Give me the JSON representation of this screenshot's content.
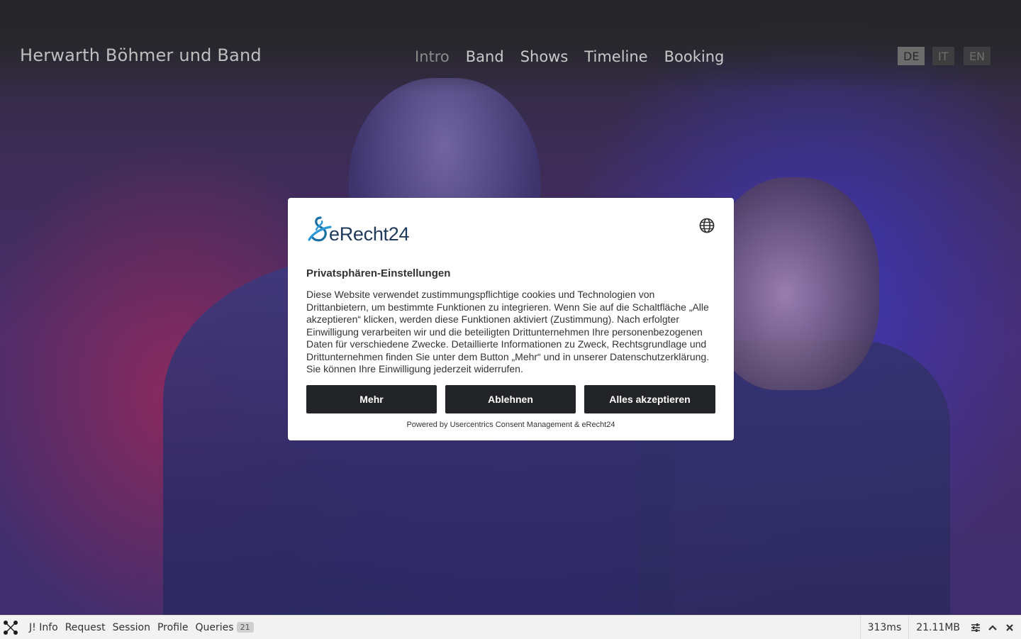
{
  "site": {
    "title": "Herwarth Böhmer und Band"
  },
  "nav": {
    "items": [
      {
        "label": "Intro",
        "active": true
      },
      {
        "label": "Band",
        "active": false
      },
      {
        "label": "Shows",
        "active": false
      },
      {
        "label": "Timeline",
        "active": false
      },
      {
        "label": "Booking",
        "active": false
      }
    ]
  },
  "languages": [
    {
      "code": "DE",
      "active": true
    },
    {
      "code": "IT",
      "active": false
    },
    {
      "code": "EN",
      "active": false
    }
  ],
  "consent": {
    "logo_text": "eRecht24",
    "language_icon": "globe-icon",
    "title": "Privatsphären-Einstellungen",
    "body": "Diese Website verwendet zustimmungspflichtige cookies und Technologien von Drittanbietern, um bestimmte Funktionen zu integrieren. Wenn Sie auf die Schaltfläche „Alle akzeptieren“ klicken, werden diese Funktionen aktiviert (Zustimmung). Nach erfolgter Einwilligung verarbeiten wir und die beteiligten Drittunternehmen Ihre personenbezogenen Daten für verschiedene Zwecke. Detaillierte Informationen zu Zweck, Rechtsgrundlage und Drittunternehmen finden Sie unter dem Button „Mehr“ und in unserer Datenschutzerklärung. Sie können Ihre Einwilligung jederzeit widerrufen.",
    "buttons": {
      "more": "Mehr",
      "decline": "Ablehnen",
      "accept_all": "Alles akzeptieren"
    },
    "powered_by": "Powered by Usercentrics Consent Management & eRecht24"
  },
  "debugbar": {
    "logo_icon": "joomla-icon",
    "items": [
      "J! Info",
      "Request",
      "Session",
      "Profile",
      "Queries"
    ],
    "queries_count": "21",
    "time": "313ms",
    "memory": "21.11MB",
    "icons": [
      "settings-icon",
      "chevron-up-icon",
      "close-icon"
    ]
  },
  "colors": {
    "button_bg": "#232427",
    "brand_blue": "#1a6fa3",
    "debugbar_bg": "#f2f2f2"
  }
}
